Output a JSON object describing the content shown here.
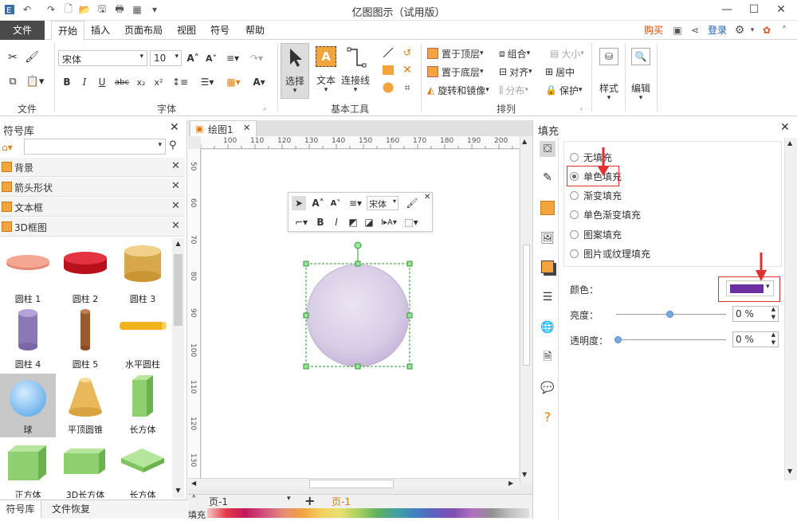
{
  "app": {
    "title": "亿图图示（试用版）"
  },
  "window_controls": {
    "minimize": "—",
    "maximize": "☐",
    "close": "✕"
  },
  "menubar": {
    "file": "文件",
    "tabs": [
      "开始",
      "插入",
      "页面布局",
      "视图",
      "符号",
      "帮助"
    ],
    "right": {
      "buy": "购买",
      "login": "登录"
    }
  },
  "ribbon": {
    "groups": {
      "file": "文件",
      "font": "字体",
      "basic_tools": "基本工具",
      "arrange": "排列"
    },
    "font_name": "宋体",
    "font_size": "10",
    "tools": {
      "select": "选择",
      "text": "文本",
      "connector": "连接线"
    },
    "arrange": {
      "bring_front": "置于顶层",
      "send_back": "置于底层",
      "rotate_mirror": "旋转和镜像",
      "group": "组合",
      "size": "大小",
      "align": "对齐",
      "center": "居中",
      "distribute": "分布",
      "protect": "保护"
    },
    "style": "样式",
    "edit": "编辑"
  },
  "symbol_library": {
    "title": "符号库",
    "categories": [
      "背景",
      "箭头形状",
      "文本框",
      "3D框图"
    ],
    "shapes": [
      "圆柱 1",
      "圆柱 2",
      "圆柱 3",
      "圆柱 4",
      "圆柱 5",
      "水平圆柱",
      "球",
      "平顶圆锥",
      "长方体",
      "正方体",
      "3D长方体",
      "长方体"
    ],
    "bottom_tabs": [
      "符号库",
      "文件恢复"
    ]
  },
  "document": {
    "tab": "绘图1",
    "ruler_h": [
      "100",
      "110",
      "120",
      "130",
      "140",
      "150",
      "160",
      "170",
      "180",
      "190",
      "200"
    ],
    "ruler_v": [
      "50",
      "60",
      "70",
      "80",
      "90",
      "100",
      "110",
      "120",
      "130"
    ],
    "page_selector": "页-1",
    "page_tab": "页-1",
    "fill_label": "填充"
  },
  "mini_toolbar": {
    "font_name": "宋体"
  },
  "fill_panel": {
    "title": "填充",
    "options": [
      "无填充",
      "单色填充",
      "渐变填充",
      "单色渐变填充",
      "图案填充",
      "图片或纹理填充"
    ],
    "selected_index": 1,
    "color_label": "颜色：",
    "color_value": "#6b2fa0",
    "brightness_label": "亮度：",
    "brightness_value": "0 %",
    "transparency_label": "透明度：",
    "transparency_value": "0 %"
  },
  "colors": {
    "accent_orange": "#f3a43a",
    "annotation_red": "#e03030",
    "sphere_fill": "#d7cce4",
    "selection_green": "#2e9b2e"
  }
}
